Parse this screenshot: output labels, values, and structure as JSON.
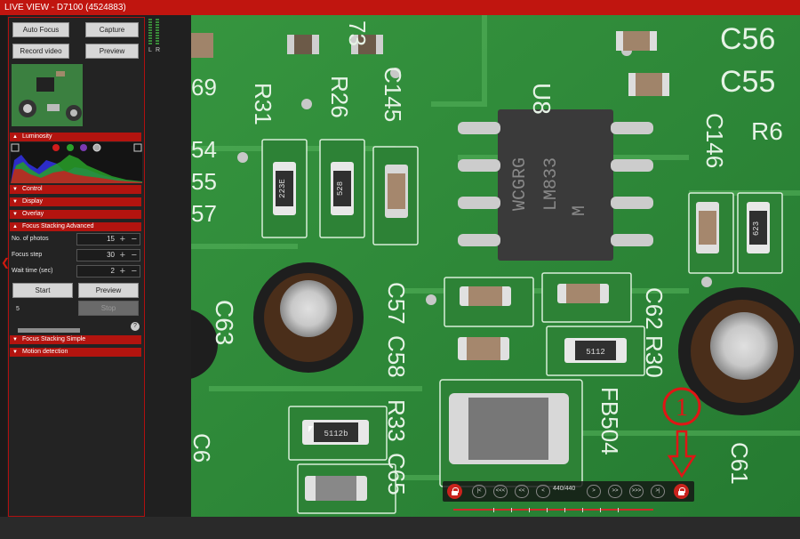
{
  "window": {
    "title": "LIVE VIEW - D7100 (4524883)"
  },
  "buttons": {
    "auto_focus": "Auto Focus",
    "capture": "Capture",
    "record_video": "Record video",
    "preview": "Preview"
  },
  "sections": {
    "luminosity": "Luminosity",
    "control": "Control",
    "display": "Display",
    "overlay": "Overlay",
    "focus_stacking_advanced": "Focus Stacking Advanced",
    "focus_stacking_simple": "Focus Stacking Simple",
    "motion_detection": "Motion detection"
  },
  "focus_stacking": {
    "no_of_photos_label": "No. of photos",
    "no_of_photos": "15",
    "focus_step_label": "Focus step",
    "focus_step": "30",
    "wait_time_label": "Wait time (sec)",
    "wait_time": "2",
    "start": "Start",
    "preview": "Preview",
    "stop": "Stop",
    "step_number": "5",
    "help": "?"
  },
  "vu_meter": {
    "left": "L",
    "right": "R"
  },
  "navigation": {
    "counter": "440/440",
    "first": "|<",
    "back_fast": "<<<",
    "back": "<<",
    "prev": "<",
    "next": ">",
    "forward": ">>",
    "forward_fast": ">>>",
    "last": ">|"
  },
  "board_labels": {
    "c56": "C56",
    "c55": "C55",
    "u8": "U8",
    "c145": "C145",
    "r26": "R26",
    "r31": "R31",
    "c146": "C146",
    "r6": "R6",
    "c63": "C63",
    "c57": "C57",
    "c58": "C58",
    "c62": "C62",
    "r30": "R30",
    "r33": "R33",
    "c65": "C65",
    "fb504": "FB504",
    "c61": "C61",
    "c69": "69",
    "c54": "54",
    "c55b": "55",
    "c57b": "57",
    "c73": "73",
    "c6": "C6",
    "chip_line1": "WCGRG",
    "chip_line2": "LM833",
    "chip_line3": "M",
    "r1": "223E",
    "r2": "528",
    "r3": "5112",
    "r4": "623",
    "r5": "5112b"
  },
  "annotation": {
    "marker": "1"
  },
  "colors": {
    "accent": "#c0150f",
    "board": "#2c8a3c"
  }
}
